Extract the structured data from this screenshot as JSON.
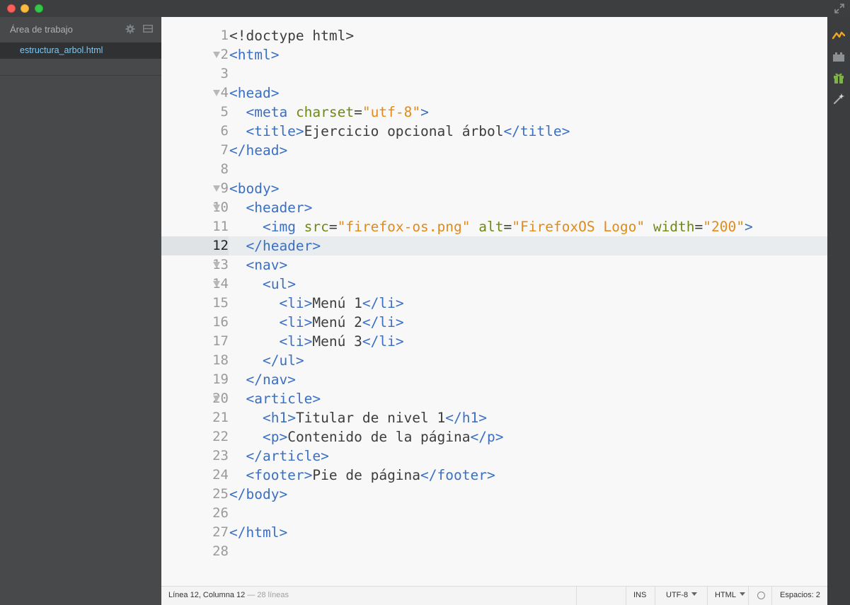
{
  "window": {
    "buttons": [
      "close",
      "minimize",
      "zoom"
    ]
  },
  "sidebar": {
    "workspace_title": "Área de trabajo",
    "icons": [
      "gear-icon",
      "split-view-icon"
    ],
    "files": [
      "estructura_arbol.html"
    ]
  },
  "editor": {
    "active_line": 12,
    "lines": [
      {
        "n": "1",
        "fold": false,
        "tokens": [
          [
            "t",
            "<!doctype html>"
          ]
        ]
      },
      {
        "n": "2",
        "fold": true,
        "tokens": [
          [
            "g",
            "<html>"
          ]
        ]
      },
      {
        "n": "3",
        "fold": false,
        "tokens": []
      },
      {
        "n": "4",
        "fold": true,
        "tokens": [
          [
            "g",
            "<head>"
          ]
        ]
      },
      {
        "n": "5",
        "fold": false,
        "tokens": [
          [
            "s",
            "  "
          ],
          [
            "g",
            "<meta "
          ],
          [
            "a",
            "charset"
          ],
          [
            "t",
            "="
          ],
          [
            "v",
            "\"utf-8\""
          ],
          [
            "g",
            ">"
          ]
        ]
      },
      {
        "n": "6",
        "fold": false,
        "tokens": [
          [
            "s",
            "  "
          ],
          [
            "g",
            "<title>"
          ],
          [
            "t",
            "Ejercicio opcional árbol"
          ],
          [
            "g",
            "</title>"
          ]
        ]
      },
      {
        "n": "7",
        "fold": false,
        "tokens": [
          [
            "g",
            "</head>"
          ]
        ]
      },
      {
        "n": "8",
        "fold": false,
        "tokens": []
      },
      {
        "n": "9",
        "fold": true,
        "tokens": [
          [
            "g",
            "<body>"
          ]
        ]
      },
      {
        "n": "10",
        "fold": true,
        "tokens": [
          [
            "s",
            "  "
          ],
          [
            "g",
            "<header>"
          ]
        ]
      },
      {
        "n": "11",
        "fold": false,
        "tokens": [
          [
            "s",
            "    "
          ],
          [
            "g",
            "<img "
          ],
          [
            "a",
            "src"
          ],
          [
            "t",
            "="
          ],
          [
            "v",
            "\"firefox-os.png\""
          ],
          [
            "t",
            " "
          ],
          [
            "a",
            "alt"
          ],
          [
            "t",
            "="
          ],
          [
            "v",
            "\"FirefoxOS Logo\""
          ],
          [
            "t",
            " "
          ],
          [
            "a",
            "width"
          ],
          [
            "t",
            "="
          ],
          [
            "v",
            "\"200\""
          ],
          [
            "g",
            ">"
          ]
        ]
      },
      {
        "n": "12",
        "fold": false,
        "tokens": [
          [
            "s",
            "  "
          ],
          [
            "g",
            "</header>"
          ]
        ]
      },
      {
        "n": "13",
        "fold": true,
        "tokens": [
          [
            "s",
            "  "
          ],
          [
            "g",
            "<nav>"
          ]
        ]
      },
      {
        "n": "14",
        "fold": true,
        "tokens": [
          [
            "s",
            "    "
          ],
          [
            "g",
            "<ul>"
          ]
        ]
      },
      {
        "n": "15",
        "fold": false,
        "tokens": [
          [
            "s",
            "      "
          ],
          [
            "g",
            "<li>"
          ],
          [
            "t",
            "Menú 1"
          ],
          [
            "g",
            "</li>"
          ]
        ]
      },
      {
        "n": "16",
        "fold": false,
        "tokens": [
          [
            "s",
            "      "
          ],
          [
            "g",
            "<li>"
          ],
          [
            "t",
            "Menú 2"
          ],
          [
            "g",
            "</li>"
          ]
        ]
      },
      {
        "n": "17",
        "fold": false,
        "tokens": [
          [
            "s",
            "      "
          ],
          [
            "g",
            "<li>"
          ],
          [
            "t",
            "Menú 3"
          ],
          [
            "g",
            "</li>"
          ]
        ]
      },
      {
        "n": "18",
        "fold": false,
        "tokens": [
          [
            "s",
            "    "
          ],
          [
            "g",
            "</ul>"
          ]
        ]
      },
      {
        "n": "19",
        "fold": false,
        "tokens": [
          [
            "s",
            "  "
          ],
          [
            "g",
            "</nav>"
          ]
        ]
      },
      {
        "n": "20",
        "fold": true,
        "tokens": [
          [
            "s",
            "  "
          ],
          [
            "g",
            "<article>"
          ]
        ]
      },
      {
        "n": "21",
        "fold": false,
        "tokens": [
          [
            "s",
            "    "
          ],
          [
            "g",
            "<h1>"
          ],
          [
            "t",
            "Titular de nivel 1"
          ],
          [
            "g",
            "</h1>"
          ]
        ]
      },
      {
        "n": "22",
        "fold": false,
        "tokens": [
          [
            "s",
            "    "
          ],
          [
            "g",
            "<p>"
          ],
          [
            "t",
            "Contenido de la página"
          ],
          [
            "g",
            "</p>"
          ]
        ]
      },
      {
        "n": "23",
        "fold": false,
        "tokens": [
          [
            "s",
            "  "
          ],
          [
            "g",
            "</article>"
          ]
        ]
      },
      {
        "n": "24",
        "fold": false,
        "tokens": [
          [
            "s",
            "  "
          ],
          [
            "g",
            "<footer>"
          ],
          [
            "t",
            "Pie de página"
          ],
          [
            "g",
            "</footer>"
          ]
        ]
      },
      {
        "n": "25",
        "fold": false,
        "tokens": [
          [
            "g",
            "</body>"
          ]
        ]
      },
      {
        "n": "26",
        "fold": false,
        "tokens": []
      },
      {
        "n": "27",
        "fold": false,
        "tokens": [
          [
            "g",
            "</html>"
          ]
        ]
      },
      {
        "n": "28",
        "fold": false,
        "tokens": []
      }
    ]
  },
  "toolbar": {
    "icons": [
      "live-preview-icon",
      "extension-manager-icon",
      "gift-icon",
      "magic-wand-icon"
    ]
  },
  "status": {
    "cursor": "Línea 12, Columna 12",
    "line_count": "— 28 líneas",
    "mode": "INS",
    "encoding": "UTF-8",
    "language": "HTML",
    "indent": "Espacios: 2"
  }
}
